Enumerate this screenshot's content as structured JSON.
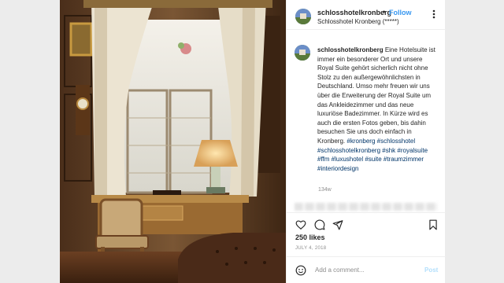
{
  "post": {
    "username": "schlosshotelkronberg",
    "separator": "•",
    "follow_label": "Follow",
    "location": "Schlosshotel Kronberg (*****)",
    "caption_text": "Eine Hotelsuite ist immer ein besonderer Ort und unsere Royal Suite gehört sicherlich nicht ohne Stolz zu den außergewöhnlichsten in Deutschland. Umso mehr freuen wir uns über die Erweiterung der Royal Suite um das Ankleidezimmer und das neue luxuriöse Badezimmer. In Kürze wird es auch die ersten Fotos geben, bis dahin besuchen Sie uns doch einfach in Kronberg.",
    "hashtags": "#kronberg #schlosshotel #schlosshotelkronberg #shk #royalsuite #ffm #luxushotel #suite #traumzimmer #interiordesign",
    "time_ago": "134w",
    "likes": "250 likes",
    "date": "JULY 4, 2018",
    "add_comment_placeholder": "Add a comment...",
    "post_button": "Post"
  },
  "icons": {
    "more": "more-options-icon",
    "like": "heart-icon",
    "comment": "comment-icon",
    "share": "share-icon",
    "save": "bookmark-icon",
    "emoji": "emoji-icon"
  },
  "colors": {
    "link": "#3897f0",
    "hashtag": "#003569",
    "muted": "#8e8e8e",
    "text": "#262626"
  }
}
